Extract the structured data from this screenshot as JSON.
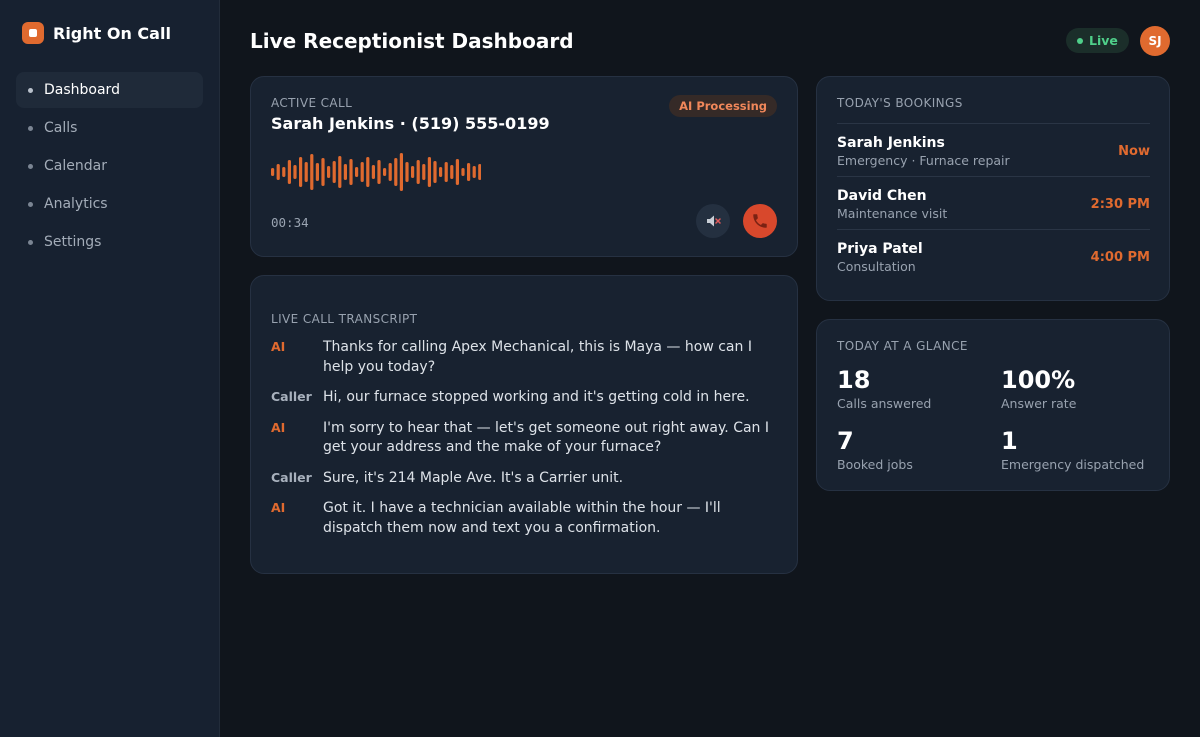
{
  "brand": {
    "name": "Right On Call"
  },
  "nav": {
    "items": [
      {
        "label": "Dashboard",
        "active": true
      },
      {
        "label": "Calls"
      },
      {
        "label": "Calendar"
      },
      {
        "label": "Analytics"
      },
      {
        "label": "Settings"
      }
    ]
  },
  "header": {
    "title": "Live Receptionist Dashboard",
    "status": "Live",
    "avatar_initials": "SJ"
  },
  "active_call": {
    "label": "ACTIVE CALL",
    "caller": "Sarah Jenkins · (519) 555-0199",
    "badge": "AI Processing",
    "timer": "00:34",
    "mute_icon": "mute-icon",
    "hangup_icon": "phone-hangup-icon"
  },
  "transcript": {
    "label": "LIVE CALL TRANSCRIPT",
    "messages": [
      {
        "speaker": "AI",
        "text": "Thanks for calling Apex Mechanical, this is Maya — how can I help you today?"
      },
      {
        "speaker": "Caller",
        "text": "Hi, our furnace stopped working and it's getting cold in here."
      },
      {
        "speaker": "AI",
        "text": "I'm sorry to hear that — let's get someone out right away. Can I get your address and the make of your furnace?"
      },
      {
        "speaker": "Caller",
        "text": "Sure, it's 214 Maple Ave. It's a Carrier unit."
      },
      {
        "speaker": "AI",
        "text": "Got it. I have a technician available within the hour — I'll dispatch them now and text you a confirmation."
      }
    ]
  },
  "bookings": {
    "label": "TODAY'S BOOKINGS",
    "items": [
      {
        "name": "Sarah Jenkins",
        "desc": "Emergency · Furnace repair",
        "time": "Now"
      },
      {
        "name": "David Chen",
        "desc": "Maintenance visit",
        "time": "2:30 PM"
      },
      {
        "name": "Priya Patel",
        "desc": "Consultation",
        "time": "4:00 PM"
      }
    ]
  },
  "glance": {
    "label": "TODAY AT A GLANCE",
    "stats": [
      {
        "value": "18",
        "label": "Calls answered"
      },
      {
        "value": "100%",
        "label": "Answer rate"
      },
      {
        "value": "7",
        "label": "Booked jobs"
      },
      {
        "value": "1",
        "label": "Emergency dispatched"
      }
    ]
  },
  "colors": {
    "accent": "#e06a2f",
    "live": "#4fcf8a",
    "hangup": "#d8482c"
  }
}
